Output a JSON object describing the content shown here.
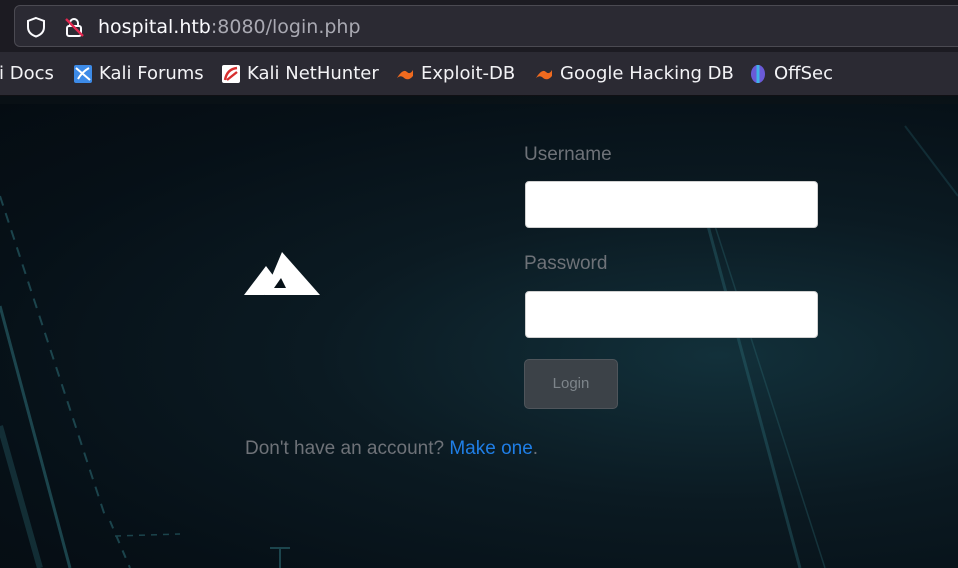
{
  "browser": {
    "url_host": "hospital.htb",
    "url_rest": ":8080/login.php",
    "bookmarks": [
      {
        "label": "li Docs",
        "icon": "kali-docs-icon"
      },
      {
        "label": "Kali Forums",
        "icon": "kali-forums-icon"
      },
      {
        "label": "Kali NetHunter",
        "icon": "kali-nethunter-icon"
      },
      {
        "label": "Exploit-DB",
        "icon": "exploit-db-icon"
      },
      {
        "label": "Google Hacking DB",
        "icon": "google-hacking-db-icon"
      },
      {
        "label": "OffSec",
        "icon": "offsec-icon"
      }
    ]
  },
  "login": {
    "logo_icon": "mountain-logo-icon",
    "username_label": "Username",
    "username_value": "",
    "password_label": "Password",
    "password_value": "",
    "submit_label": "Login",
    "signup_prefix": "Don't have an account? ",
    "signup_link": "Make one",
    "signup_suffix": "."
  },
  "colors": {
    "link": "#1f7ee6",
    "page_bg": "#061017",
    "accent_teal": "#2e6f78"
  }
}
